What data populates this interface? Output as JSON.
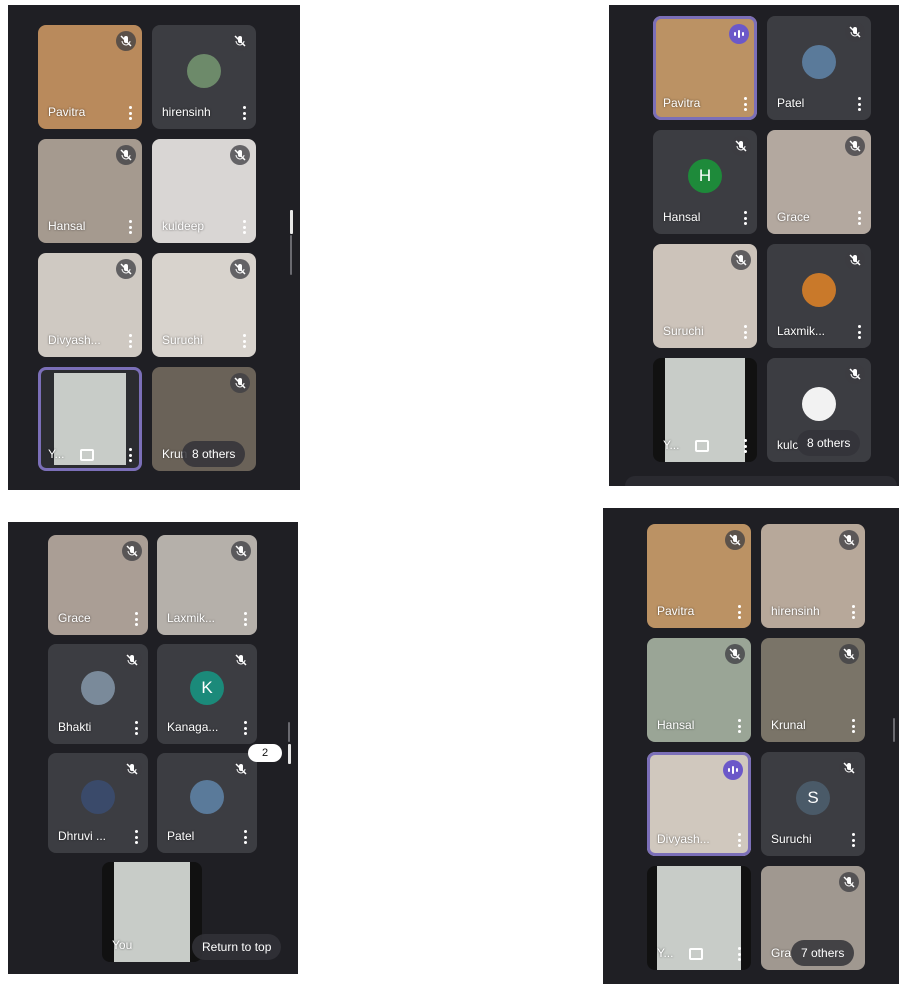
{
  "screens": {
    "a": {
      "tiles": [
        {
          "label": "Pavitra",
          "muted": true,
          "bg": "#b98a5c"
        },
        {
          "label": "hirensinh",
          "muted": true,
          "avatar_color": "#6d8a6a",
          "bg": "#3c3d42"
        },
        {
          "label": "Hansal",
          "muted": true,
          "bg": "#a59a8f"
        },
        {
          "label": "kuldeep",
          "muted": true,
          "bg": "#d9d6d4"
        },
        {
          "label": "Divyash...",
          "muted": true,
          "bg": "#cfc9c2"
        },
        {
          "label": "Suruchi",
          "muted": true,
          "bg": "#d8d3cd"
        },
        {
          "label": "Y...",
          "muted": false,
          "bg": "#c8ccc8"
        },
        {
          "label": "Krun",
          "muted": true,
          "bg": "#6a6258"
        }
      ],
      "others": "8 others"
    },
    "b": {
      "tiles": [
        {
          "label": "Pavitra",
          "speaking": true,
          "bg": "#bb9264"
        },
        {
          "label": "Patel",
          "muted": true,
          "avatar_color": "#5a7a9a",
          "bg": "#3c3d42"
        },
        {
          "label": "Hansal",
          "muted": true,
          "avatar_letter": "H",
          "avatar_color": "#1e8a3a",
          "bg": "#3c3d42"
        },
        {
          "label": "Grace",
          "muted": true,
          "bg": "#b3a89f"
        },
        {
          "label": "Suruchi",
          "muted": true,
          "bg": "#ccc3ba"
        },
        {
          "label": "Laxmik...",
          "muted": true,
          "avatar_color": "#c9792a",
          "bg": "#3c3d42"
        },
        {
          "label": "Y...",
          "muted": false,
          "bg": "#c8ccc8"
        },
        {
          "label": "kulc",
          "muted": true,
          "avatar_color": "#f2f2f2",
          "bg": "#3c3d42"
        }
      ],
      "others": "8 others"
    },
    "c": {
      "tiles": [
        {
          "label": "Grace",
          "muted": true,
          "bg": "#aa9e95"
        },
        {
          "label": "Laxmik...",
          "muted": true,
          "bg": "#b5b0aa"
        },
        {
          "label": "Bhakti",
          "muted": true,
          "avatar_color": "#7a8a9a",
          "bg": "#3c3d42"
        },
        {
          "label": "Kanaga...",
          "muted": true,
          "avatar_letter": "K",
          "avatar_color": "#1b8a7a",
          "bg": "#3c3d42"
        },
        {
          "label": "Dhruvi ...",
          "muted": true,
          "avatar_color": "#3a4a6a",
          "bg": "#3c3d42"
        },
        {
          "label": "Patel",
          "muted": true,
          "avatar_color": "#5a7a9a",
          "bg": "#3c3d42"
        }
      ],
      "self_label": "You",
      "page_number": "2",
      "return_label": "Return to top"
    },
    "d": {
      "tiles": [
        {
          "label": "Pavitra",
          "muted": true,
          "bg": "#bb9264"
        },
        {
          "label": "hirensinh",
          "muted": true,
          "bg": "#b7a89a"
        },
        {
          "label": "Hansal",
          "muted": true,
          "bg": "#9aa596"
        },
        {
          "label": "Krunal",
          "muted": true,
          "bg": "#7a7468"
        },
        {
          "label": "Divyash...",
          "speaking": true,
          "bg": "#d0c8be"
        },
        {
          "label": "Suruchi",
          "muted": true,
          "avatar_letter": "S",
          "avatar_color": "#4a5a68",
          "bg": "#3c3d42"
        },
        {
          "label": "Y...",
          "muted": false,
          "bg": "#c8ccc8"
        },
        {
          "label": "Gra",
          "muted": true,
          "bg": "#a09890"
        }
      ],
      "others": "7 others"
    }
  }
}
